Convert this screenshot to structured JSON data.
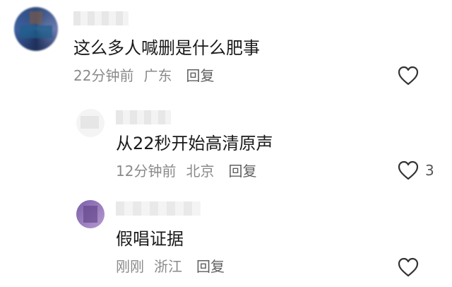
{
  "comments": [
    {
      "content": "这么多人喊删是什么肥事",
      "time": "22分钟前",
      "location": "广东",
      "reply_label": "回复",
      "like_count": ""
    },
    {
      "content": "从22秒开始高清原声",
      "time": "12分钟前",
      "location": "北京",
      "reply_label": "回复",
      "like_count": "3"
    },
    {
      "content": "假唱证据",
      "time": "刚刚",
      "location": "浙江",
      "reply_label": "回复",
      "like_count": ""
    }
  ],
  "icons": {
    "like": "heart-outline-icon"
  },
  "colors": {
    "text": "#1a1a1a",
    "meta": "#8a8a8a",
    "icon": "#333333"
  }
}
